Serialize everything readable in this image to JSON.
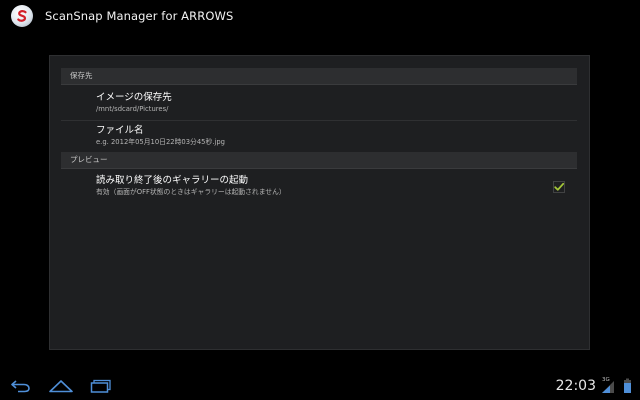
{
  "app": {
    "title": "ScanSnap Manager for ARROWS",
    "icon": "scansnap-logo-icon"
  },
  "preferences": {
    "categories": [
      {
        "label": "保存先",
        "items": [
          {
            "title": "イメージの保存先",
            "summary": "/mnt/sdcard/Pictures/"
          },
          {
            "title": "ファイル名",
            "summary": "e.g. 2012年05月10日22時03分45秒.jpg"
          }
        ]
      },
      {
        "label": "プレビュー",
        "items": [
          {
            "title": "読み取り終了後のギャラリーの起動",
            "summary": "有効（画面がOFF状態のときはギャラリーは起動されません）",
            "checked": true
          }
        ]
      }
    ]
  },
  "system_bar": {
    "clock": "22:03",
    "network_type": "3G",
    "icons": [
      "back-icon",
      "home-icon",
      "recent-apps-icon",
      "signal-icon",
      "battery-icon"
    ]
  },
  "colors": {
    "accent_check": "#a4c639",
    "panel_bg": "#1e1f21",
    "category_bg": "#2d2e30"
  }
}
